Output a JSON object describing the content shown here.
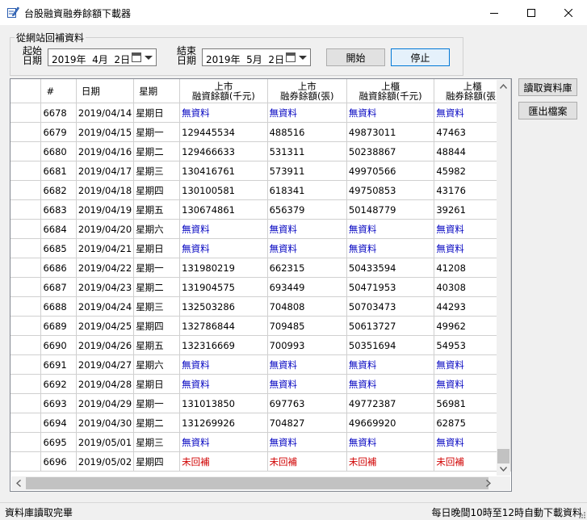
{
  "window": {
    "title": "台股融資融券餘額下載器"
  },
  "fetch_group": {
    "label": "從網站回補資料",
    "start_label_1": "起始",
    "start_label_2": "日期",
    "start_date": "2019年  4月  2日",
    "end_label_1": "結束",
    "end_label_2": "日期",
    "end_date": "2019年  5月  2日",
    "start_button": "開始",
    "stop_button": "停止"
  },
  "side_buttons": {
    "read_db": "讀取資料庫",
    "export": "匯出檔案"
  },
  "table": {
    "headers": [
      {
        "l1": "#",
        "l2": ""
      },
      {
        "l1": "日期",
        "l2": ""
      },
      {
        "l1": "星期",
        "l2": ""
      },
      {
        "l1": "上市",
        "l2": "融資餘額(千元)"
      },
      {
        "l1": "上市",
        "l2": "融券餘額(張)"
      },
      {
        "l1": "上櫃",
        "l2": "融資餘額(千元)"
      },
      {
        "l1": "上櫃",
        "l2": "融券餘額(張)"
      }
    ],
    "rows": [
      [
        "6678",
        "2019/04/14",
        "星期日",
        "無資料",
        "無資料",
        "無資料",
        "無資料"
      ],
      [
        "6679",
        "2019/04/15",
        "星期一",
        "129445534",
        "488516",
        "49873011",
        "47463"
      ],
      [
        "6680",
        "2019/04/16",
        "星期二",
        "129466633",
        "531311",
        "50238867",
        "48844"
      ],
      [
        "6681",
        "2019/04/17",
        "星期三",
        "130416761",
        "573911",
        "49970566",
        "45982"
      ],
      [
        "6682",
        "2019/04/18",
        "星期四",
        "130100581",
        "618341",
        "49750853",
        "43176"
      ],
      [
        "6683",
        "2019/04/19",
        "星期五",
        "130674861",
        "656379",
        "50148779",
        "39261"
      ],
      [
        "6684",
        "2019/04/20",
        "星期六",
        "無資料",
        "無資料",
        "無資料",
        "無資料"
      ],
      [
        "6685",
        "2019/04/21",
        "星期日",
        "無資料",
        "無資料",
        "無資料",
        "無資料"
      ],
      [
        "6686",
        "2019/04/22",
        "星期一",
        "131980219",
        "662315",
        "50433594",
        "41208"
      ],
      [
        "6687",
        "2019/04/23",
        "星期二",
        "131904575",
        "693449",
        "50471953",
        "40308"
      ],
      [
        "6688",
        "2019/04/24",
        "星期三",
        "132503286",
        "704808",
        "50703473",
        "44293"
      ],
      [
        "6689",
        "2019/04/25",
        "星期四",
        "132786844",
        "709485",
        "50613727",
        "49962"
      ],
      [
        "6690",
        "2019/04/26",
        "星期五",
        "132316669",
        "700993",
        "50351694",
        "54953"
      ],
      [
        "6691",
        "2019/04/27",
        "星期六",
        "無資料",
        "無資料",
        "無資料",
        "無資料"
      ],
      [
        "6692",
        "2019/04/28",
        "星期日",
        "無資料",
        "無資料",
        "無資料",
        "無資料"
      ],
      [
        "6693",
        "2019/04/29",
        "星期一",
        "131013850",
        "697763",
        "49772387",
        "56981"
      ],
      [
        "6694",
        "2019/04/30",
        "星期二",
        "131269926",
        "704827",
        "49669920",
        "62875"
      ],
      [
        "6695",
        "2019/05/01",
        "星期三",
        "無資料",
        "無資料",
        "無資料",
        "無資料"
      ],
      [
        "6696",
        "2019/05/02",
        "星期四",
        "未回補",
        "未回補",
        "未回補",
        "未回補"
      ]
    ]
  },
  "status": {
    "left": "資料庫讀取完畢",
    "right": "每日晚間10時至12時自動下載資料"
  },
  "colors": {
    "no_data": "#0000c0",
    "missing": "#d00000",
    "focus": "#0078d7"
  }
}
